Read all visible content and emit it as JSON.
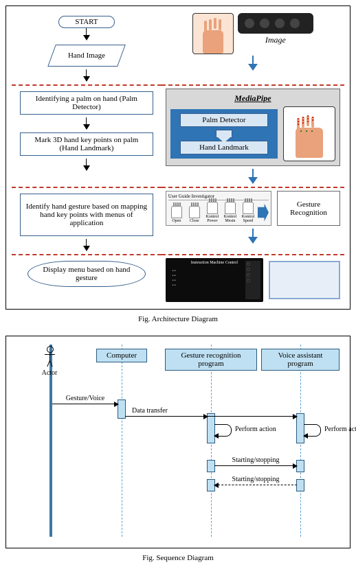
{
  "architecture": {
    "left": {
      "start": "START",
      "input": "Hand\nImage",
      "step1": "Identifying a palm on hand (Palm Detector)",
      "step2": "Mark 3D hand key points on palm (Hand Landmark)",
      "step3": "Identify hand gesture based on mapping hand key points with menus of application",
      "step4": "Display menu based on hand gesture"
    },
    "right": {
      "image_label": "Image",
      "mediapipe": {
        "title": "MediaPipe",
        "palm_detector": "Palm Detector",
        "hand_landmark": "Hand Landmark"
      },
      "guide": {
        "title": "User Guide Investigator",
        "items": [
          "Open",
          "Close",
          "Kontrol Power",
          "Kontrol Mesin",
          "Kontrol Speed"
        ]
      },
      "gesture_recognition": "Gesture Recognition",
      "screen_title": "Instruction Machine Control"
    },
    "caption": "Fig. Architecture Diagram"
  },
  "sequence": {
    "actors": {
      "actor": "Actor",
      "computer": "Computer",
      "gesture": "Gesture recognition program",
      "voice": "Voice assistant program"
    },
    "messages": {
      "m1": "Gesture/Voice",
      "m2": "Data transfer",
      "m3": "Perform action",
      "m4": "Perform action",
      "m5": "Starting/stopping",
      "m6": "Starting/stopping"
    },
    "caption": "Fig. Sequence Diagram"
  }
}
